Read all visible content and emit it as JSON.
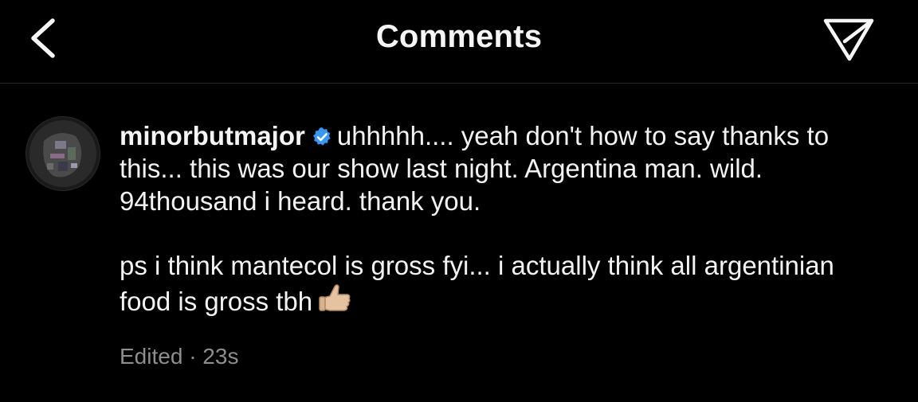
{
  "header": {
    "title": "Comments",
    "back_icon": "chevron-left-icon",
    "share_icon": "paper-plane-icon"
  },
  "comment": {
    "username": "minorbutmajor",
    "verified": true,
    "text_line1": "uhhhhh.... yeah don't how to say thanks to this... this was our show last night. Argentina man. wild. 94thousand i heard. thank you.",
    "text_line2": "ps  i think mantecol is gross fyi... i actually think all argentinian food is gross tbh",
    "emoji": "thumbs-up-light-skin-tone",
    "edited_label": "Edited",
    "separator": "·",
    "time": "23s"
  },
  "colors": {
    "background": "#000000",
    "text": "#f5f5f5",
    "meta": "#8e8e8e",
    "verified": "#3897f0",
    "divider": "#262626"
  }
}
